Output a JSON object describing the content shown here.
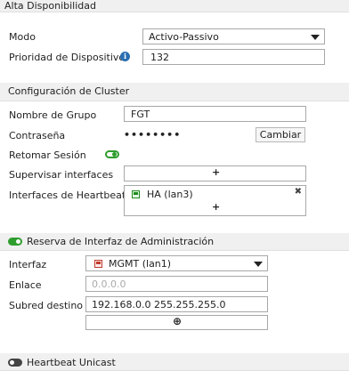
{
  "header": {
    "title": "Alta Disponibilidad"
  },
  "mode": {
    "label": "Modo",
    "value": "Activo-Passivo"
  },
  "priority": {
    "label": "Prioridad de Dispositivo",
    "value": "132"
  },
  "cluster": {
    "section_title": "Configuración de Cluster",
    "group_name_label": "Nombre de Grupo",
    "group_name_value": "FGT",
    "password_label": "Contraseña",
    "password_value": "••••••••",
    "change_button": "Cambiar",
    "session_label": "Retomar Sesión",
    "monitor_label": "Supervisar interfaces",
    "heartbeat_label": "Interfaces de Heartbeat",
    "heartbeat_item": "HA (lan3)"
  },
  "mgmt": {
    "section_title": "Reserva de Interfaz de Administración",
    "interface_label": "Interfaz",
    "interface_value": "MGMT (lan1)",
    "link_label": "Enlace",
    "link_placeholder": "0.0.0.0",
    "subnet_label": "Subred destino",
    "subnet_value": "192.168.0.0 255.255.255.0"
  },
  "unicast": {
    "section_title": "Heartbeat Unicast"
  },
  "icons": {
    "plus": "+",
    "close": "✖",
    "add_circle": "⊕",
    "info": "i"
  },
  "toggles": {
    "session": true,
    "mgmt": true,
    "unicast": false
  },
  "colors": {
    "toggle_on": "#2e9d2e",
    "info_icon": "#2a6fb3",
    "header_bg": "#f0f0f0"
  }
}
